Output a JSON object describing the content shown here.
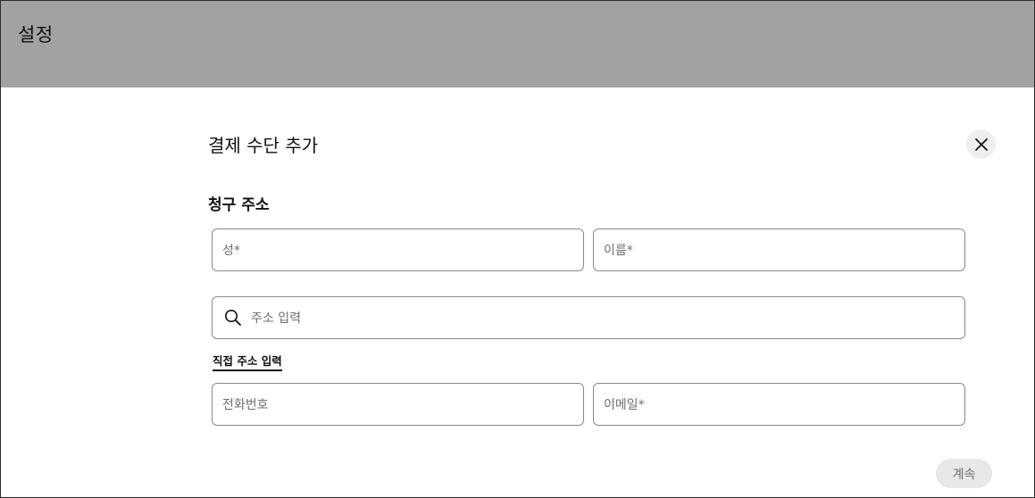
{
  "page": {
    "title": "설정"
  },
  "modal": {
    "title": "결제 수단 추가",
    "section_title": "청구 주소",
    "fields": {
      "last_name": {
        "placeholder": "성*",
        "value": ""
      },
      "first_name": {
        "placeholder": "이름*",
        "value": ""
      },
      "address_search": {
        "placeholder": "주소 입력",
        "value": ""
      },
      "phone": {
        "placeholder": "전화번호",
        "value": ""
      },
      "email": {
        "placeholder": "이메일*",
        "value": ""
      }
    },
    "manual_address_link": "직접 주소 입력",
    "continue_label": "계속"
  },
  "icons": {
    "close": "close-icon",
    "search": "search-icon"
  },
  "colors": {
    "overlay": "#a2a2a2",
    "field_border": "#8a8a8a",
    "button_disabled_bg": "#e8e8e8",
    "button_disabled_text": "#6f6f6f",
    "close_bg": "#efefef"
  }
}
